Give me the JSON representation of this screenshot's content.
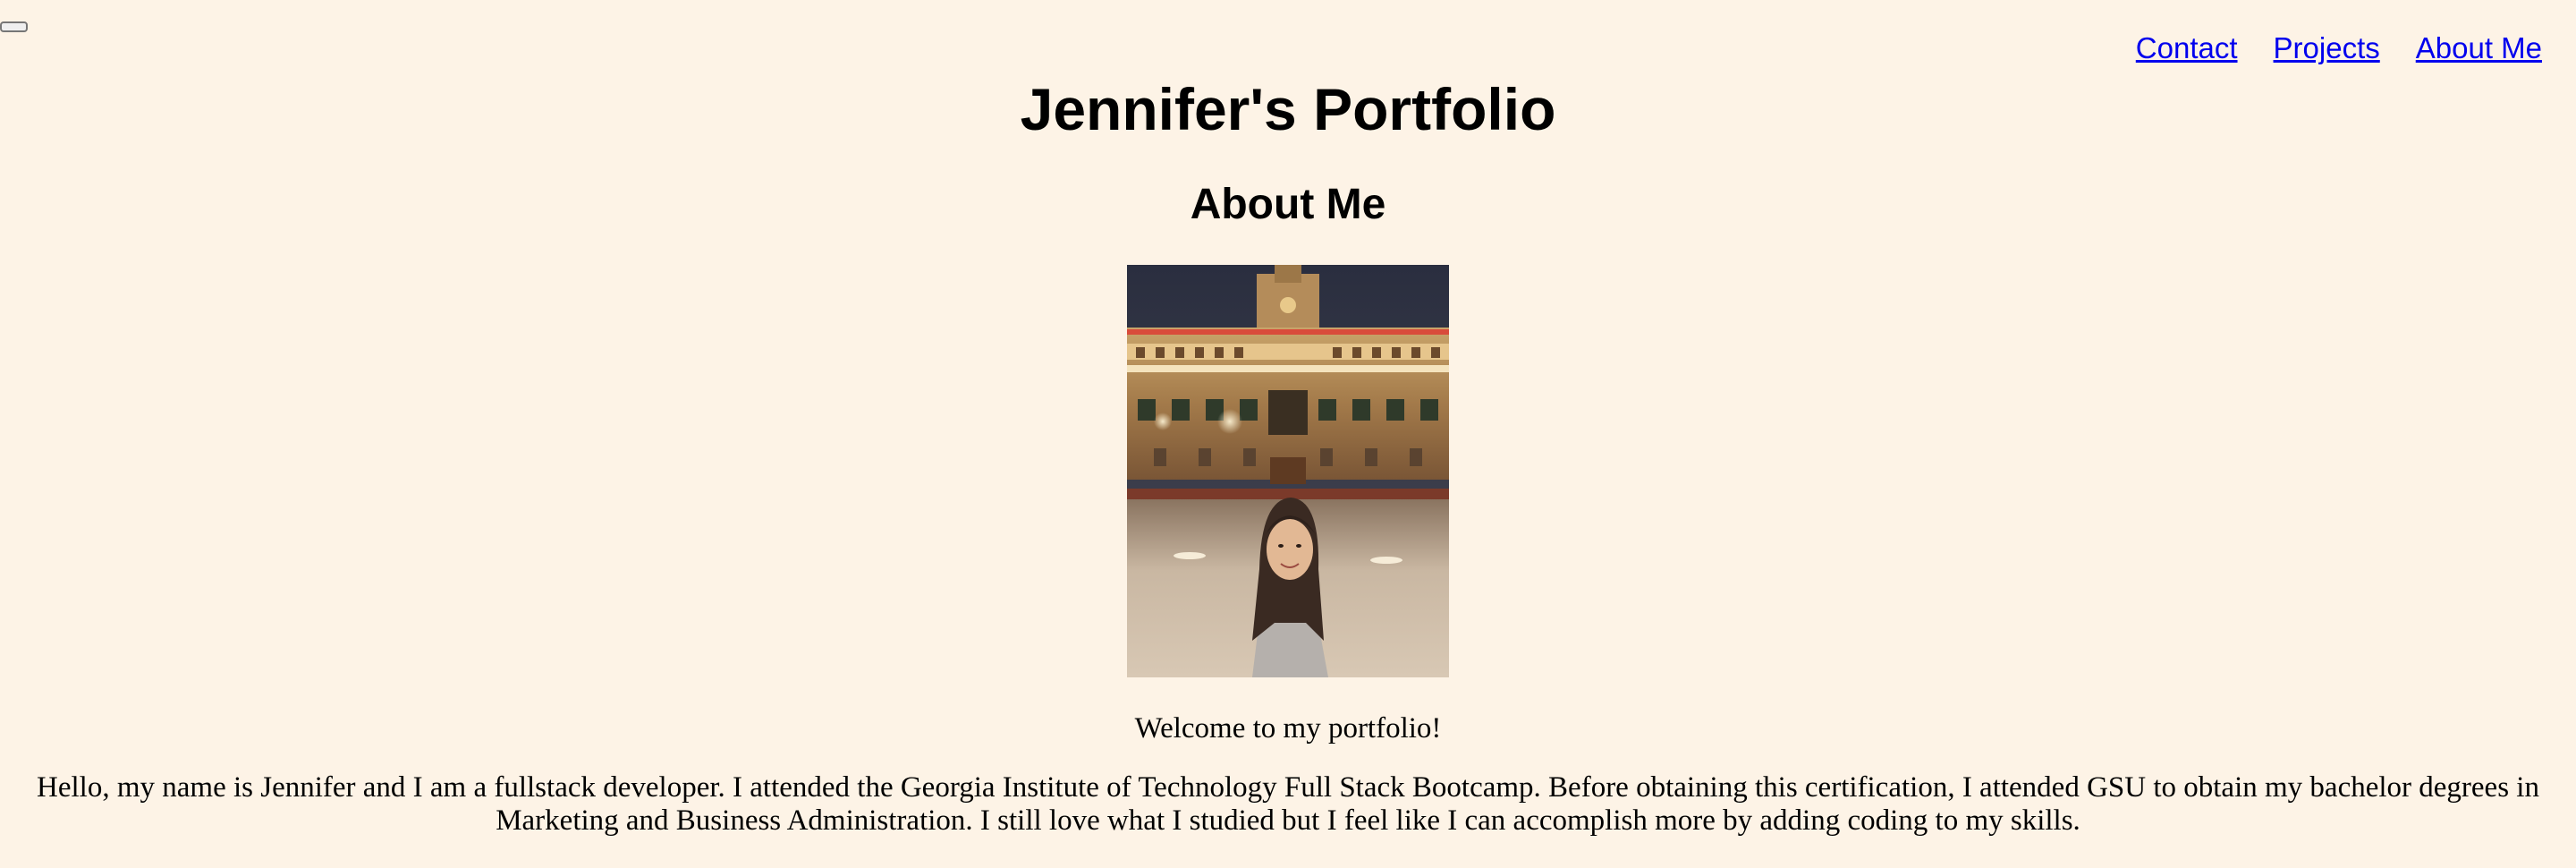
{
  "nav": {
    "links": [
      "Contact",
      "Projects",
      "About Me"
    ]
  },
  "header": {
    "title": "Jennifer's Portfolio"
  },
  "main": {
    "section_title": "About Me",
    "welcome": "Welcome to my portfolio!",
    "bio": "Hello, my name is Jennifer and I am a fullstack developer. I attended the Georgia Institute of Technology Full Stack Bootcamp. Before obtaining this certification, I attended GSU to obtain my bachelor degrees in Marketing and Business Administration. I still love what I studied but I feel like I can accomplish more by adding coding to my skills."
  },
  "colors": {
    "background": "#fdf3e6",
    "link": "#0000ee"
  }
}
